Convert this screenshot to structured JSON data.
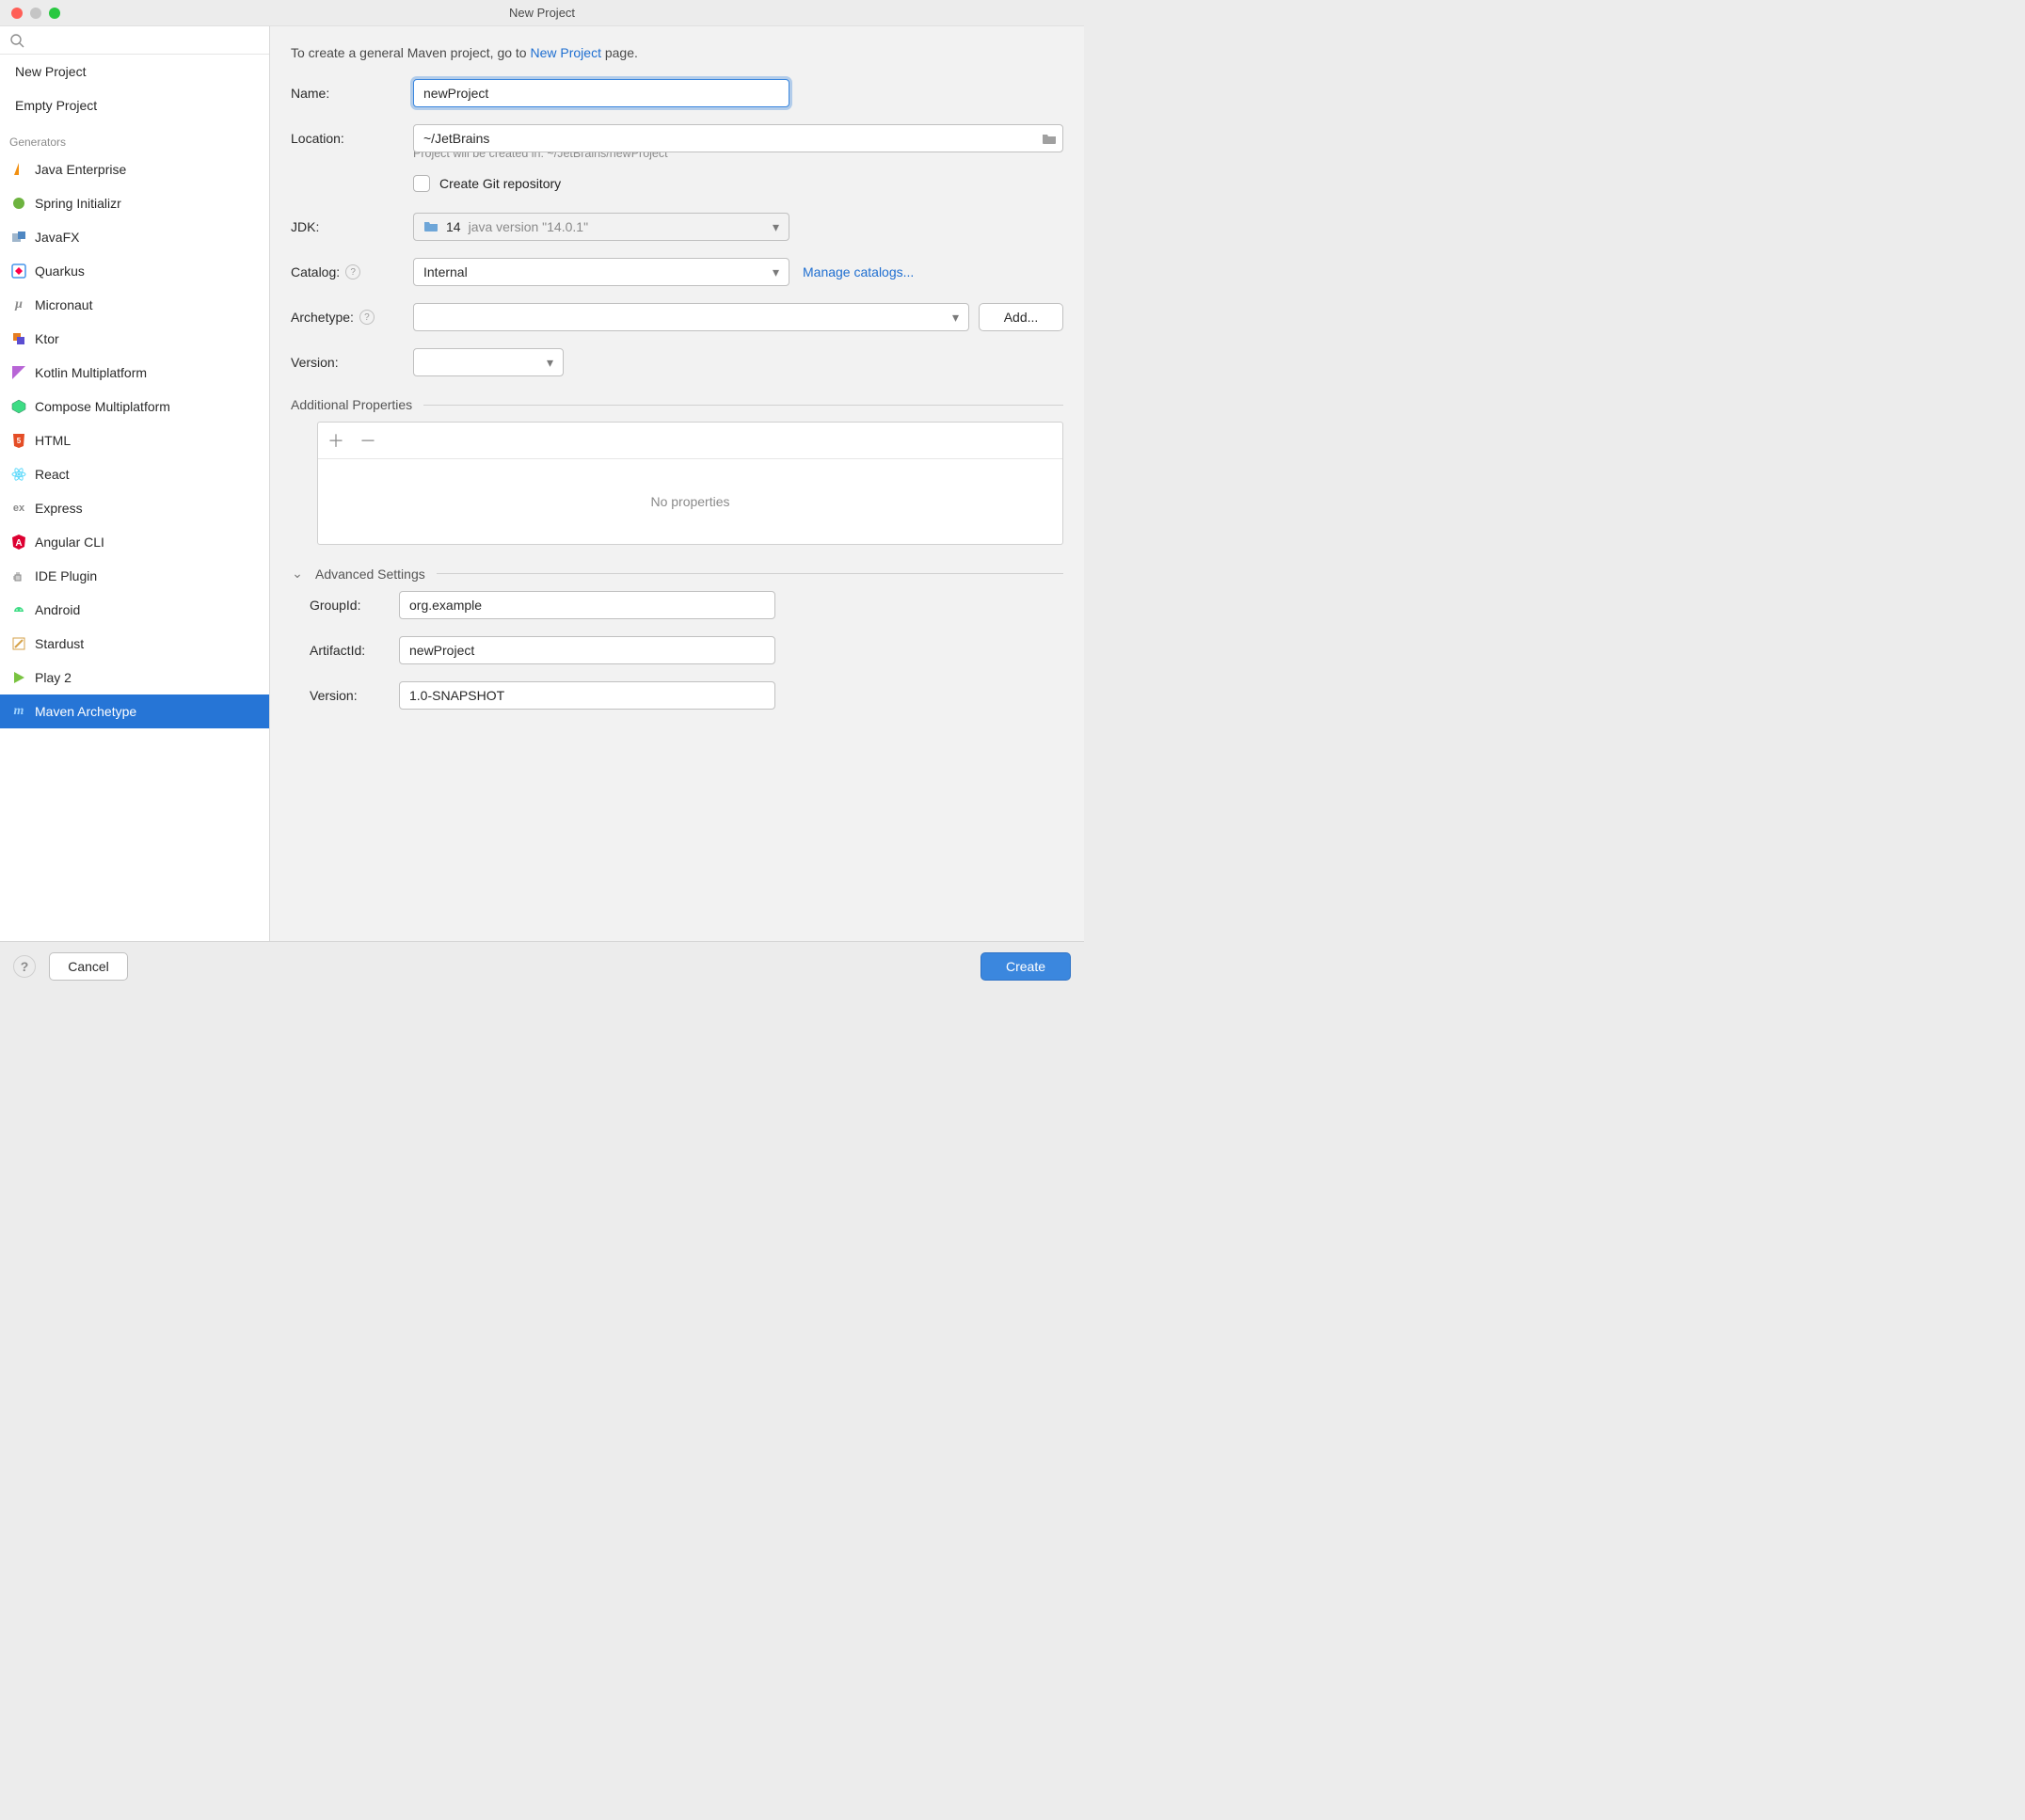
{
  "window": {
    "title": "New Project"
  },
  "sidebar": {
    "project_types": [
      {
        "label": "New Project"
      },
      {
        "label": "Empty Project"
      }
    ],
    "generators_title": "Generators",
    "generators": [
      {
        "label": "Java Enterprise"
      },
      {
        "label": "Spring Initializr"
      },
      {
        "label": "JavaFX"
      },
      {
        "label": "Quarkus"
      },
      {
        "label": "Micronaut"
      },
      {
        "label": "Ktor"
      },
      {
        "label": "Kotlin Multiplatform"
      },
      {
        "label": "Compose Multiplatform"
      },
      {
        "label": "HTML"
      },
      {
        "label": "React"
      },
      {
        "label": "Express"
      },
      {
        "label": "Angular CLI"
      },
      {
        "label": "IDE Plugin"
      },
      {
        "label": "Android"
      },
      {
        "label": "Stardust"
      },
      {
        "label": "Play 2"
      },
      {
        "label": "Maven Archetype"
      }
    ],
    "selected_generator_index": 16
  },
  "content": {
    "intro_pre": "To create a general Maven project, go to ",
    "intro_link": "New Project",
    "intro_post": " page.",
    "labels": {
      "name": "Name:",
      "location": "Location:",
      "jdk": "JDK:",
      "catalog": "Catalog:",
      "archetype": "Archetype:",
      "version": "Version:"
    },
    "name_value": "newProject",
    "location_value": "~/JetBrains",
    "location_hint": "Project will be created in: ~/JetBrains/newProject",
    "git_checkbox_label": "Create Git repository",
    "git_checked": false,
    "jdk": {
      "version": "14",
      "detail": "java version \"14.0.1\""
    },
    "catalog_value": "Internal",
    "manage_catalogs": "Manage catalogs...",
    "archetype_value": "",
    "add_button": "Add...",
    "version_value": "",
    "additional_props_title": "Additional Properties",
    "no_properties": "No properties",
    "advanced_title": "Advanced Settings",
    "advanced": {
      "group_label": "GroupId:",
      "group_value": "org.example",
      "artifact_label": "ArtifactId:",
      "artifact_value": "newProject",
      "version_label": "Version:",
      "version_value": "1.0-SNAPSHOT"
    }
  },
  "footer": {
    "cancel": "Cancel",
    "create": "Create"
  }
}
